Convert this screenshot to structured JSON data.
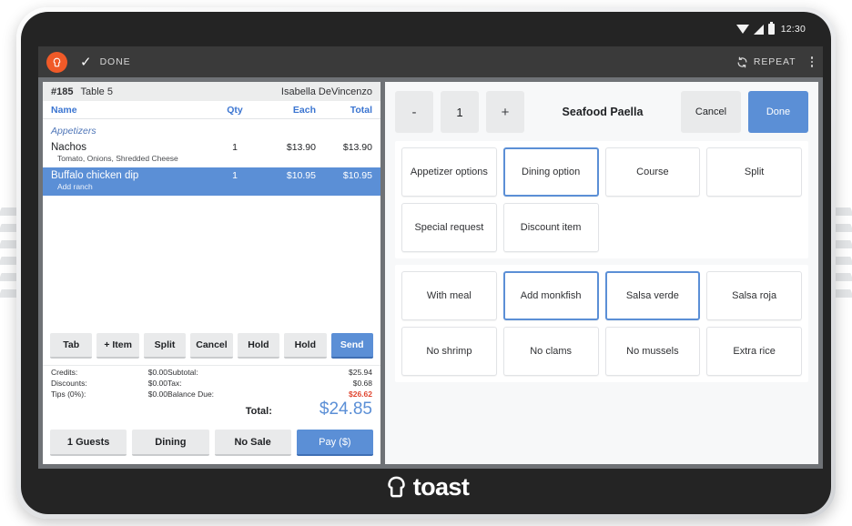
{
  "statusbar": {
    "wifi_icon": "wifi-icon",
    "signal_icon": "signal-icon",
    "battery_icon": "battery-icon",
    "time": "12:30"
  },
  "toolbar": {
    "logo_icon": "toast-logo-icon",
    "check_icon": "check-icon",
    "done_label": "DONE",
    "repeat_icon": "repeat-icon",
    "repeat_label": "REPEAT",
    "overflow_icon": "kebab-menu-icon"
  },
  "check": {
    "number": "#185",
    "table": "Table 5",
    "server": "Isabella DeVincenzo",
    "columns": {
      "name": "Name",
      "qty": "Qty",
      "each": "Each",
      "total": "Total"
    },
    "category": "Appetizers",
    "items": [
      {
        "name": "Nachos",
        "qty": "1",
        "each": "$13.90",
        "total": "$13.90",
        "mods": "Tomato, Onions, Shredded Cheese",
        "selected": false
      },
      {
        "name": "Buffalo chicken dip",
        "qty": "1",
        "each": "$10.95",
        "total": "$10.95",
        "mods": "Add ranch",
        "selected": true
      }
    ],
    "actions": [
      {
        "label": "Tab",
        "primary": false
      },
      {
        "label": "+ Item",
        "primary": false
      },
      {
        "label": "Split",
        "primary": false
      },
      {
        "label": "Cancel",
        "primary": false
      },
      {
        "label": "Hold",
        "primary": false
      },
      {
        "label": "Hold",
        "primary": false
      },
      {
        "label": "Send",
        "primary": true
      }
    ],
    "totals": {
      "credits_label": "Credits:",
      "credits_value": "$0.00",
      "discounts_label": "Discounts:",
      "discounts_value": "$0.00",
      "tips_label": "Tips (0%):",
      "tips_value": "$0.00",
      "subtotal_label": "Subtotal:",
      "subtotal_value": "$25.94",
      "tax_label": "Tax:",
      "tax_value": "$0.68",
      "balance_label": "Balance Due:",
      "balance_value": "$26.62",
      "total_label": "Total:",
      "total_value": "$24.85"
    },
    "footer": [
      {
        "label": "1 Guests",
        "primary": false
      },
      {
        "label": "Dining",
        "primary": false
      },
      {
        "label": "No Sale",
        "primary": false
      },
      {
        "label": "Pay ($)",
        "primary": true
      }
    ]
  },
  "modifier_panel": {
    "decrement_label": "-",
    "quantity": "1",
    "increment_label": "+",
    "item_name": "Seafood Paella",
    "cancel_label": "Cancel",
    "done_label": "Done",
    "option_groups": [
      {
        "label": "Appetizer options",
        "selected": false
      },
      {
        "label": "Dining option",
        "selected": true
      },
      {
        "label": "Course",
        "selected": false
      },
      {
        "label": "Split",
        "selected": false
      },
      {
        "label": "Special request",
        "selected": false
      },
      {
        "label": "Discount item",
        "selected": false
      }
    ],
    "modifiers": [
      {
        "label": "With meal",
        "selected": false
      },
      {
        "label": "Add monkfish",
        "selected": true
      },
      {
        "label": "Salsa verde",
        "selected": true
      },
      {
        "label": "Salsa roja",
        "selected": false
      },
      {
        "label": "No shrimp",
        "selected": false
      },
      {
        "label": "No clams",
        "selected": false
      },
      {
        "label": "No mussels",
        "selected": false
      },
      {
        "label": "Extra rice",
        "selected": false
      }
    ]
  },
  "brand": {
    "logo_icon": "toast-bread-icon",
    "wordmark": "toast"
  },
  "colors": {
    "accent_blue": "#5b8fd6",
    "brand_orange": "#f05a28",
    "danger_red": "#e0452f",
    "toolbar_dark": "#3a3a3a"
  }
}
